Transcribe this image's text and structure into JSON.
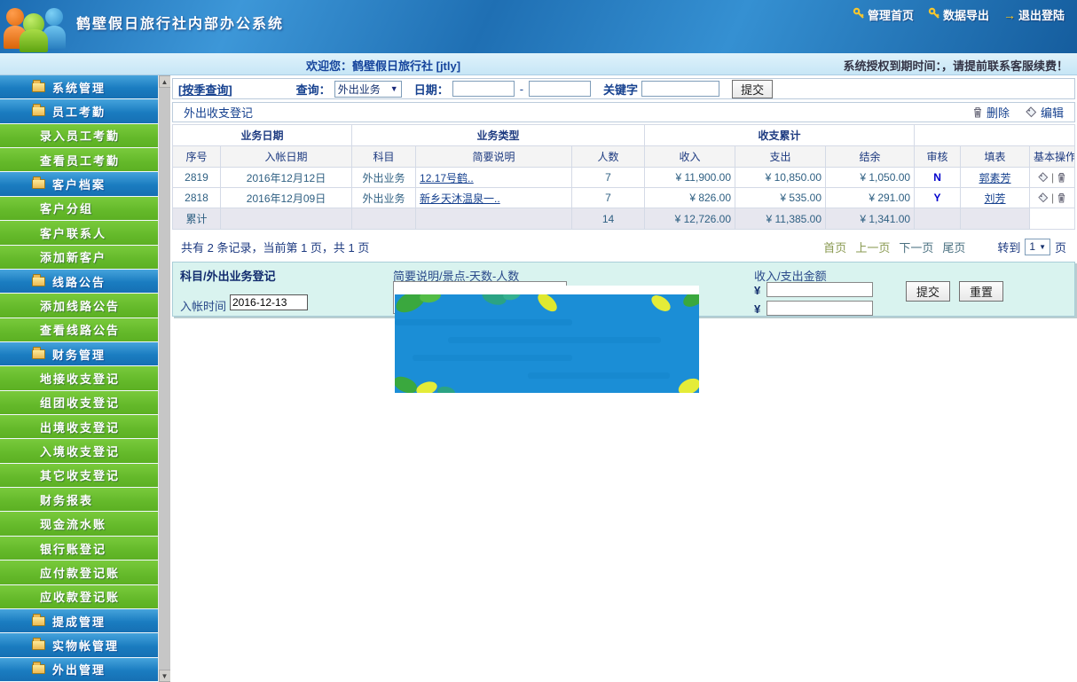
{
  "colors": {
    "income": "#009933",
    "expense": "#ee0000",
    "balance": "#25366e",
    "sidebar_blue": "#1a7cc0",
    "sidebar_green": "#64b92a",
    "header_blue": "#2b87cf",
    "form_bg": "#d9f3ef"
  },
  "icons": {
    "dropdown_arrow": "▼",
    "scroll_up": "▲",
    "scroll_down": "▼",
    "logout_arrow": "→",
    "ops_separator": "|"
  },
  "header": {
    "title": "鹤壁假日旅行社内部办公系统",
    "links": [
      {
        "label": "管理首页",
        "icon": "key-icon"
      },
      {
        "label": "数据导出",
        "icon": "key-icon"
      },
      {
        "label": "退出登陆",
        "icon": "arrow-icon"
      }
    ]
  },
  "welcome_bar": {
    "welcome_text": "欢迎您：鹤壁假日旅行社 [jtly]",
    "license_text": "系统授权到期时间：，请提前联系客服续费！"
  },
  "sidebar": {
    "items": [
      {
        "label": "系统管理",
        "type": "group"
      },
      {
        "label": "员工考勤",
        "type": "group"
      },
      {
        "label": "录入员工考勤",
        "type": "link"
      },
      {
        "label": "查看员工考勤",
        "type": "link"
      },
      {
        "label": "客户档案",
        "type": "group"
      },
      {
        "label": "客户分组",
        "type": "link"
      },
      {
        "label": "客户联系人",
        "type": "link"
      },
      {
        "label": "添加新客户",
        "type": "link"
      },
      {
        "label": "线路公告",
        "type": "group"
      },
      {
        "label": "添加线路公告",
        "type": "link"
      },
      {
        "label": "查看线路公告",
        "type": "link"
      },
      {
        "label": "财务管理",
        "type": "group"
      },
      {
        "label": "地接收支登记",
        "type": "link"
      },
      {
        "label": "组团收支登记",
        "type": "link"
      },
      {
        "label": "出境收支登记",
        "type": "link"
      },
      {
        "label": "入境收支登记",
        "type": "link"
      },
      {
        "label": "其它收支登记",
        "type": "link"
      },
      {
        "label": "财务报表",
        "type": "link"
      },
      {
        "label": "现金流水账",
        "type": "link"
      },
      {
        "label": "银行账登记",
        "type": "link"
      },
      {
        "label": "应付款登记账",
        "type": "link"
      },
      {
        "label": "应收款登记账",
        "type": "link"
      },
      {
        "label": "提成管理",
        "type": "group"
      },
      {
        "label": "实物帐管理",
        "type": "group"
      },
      {
        "label": "外出管理",
        "type": "group"
      }
    ]
  },
  "query_bar": {
    "season_link": "[按季查询]",
    "query_label": "查询：",
    "select_value": "外出业务",
    "date_label": "日期：",
    "date_from": "",
    "date_to": "",
    "separator": "-",
    "keyword_label": "关键字",
    "keyword_value": "",
    "submit_label": "提交"
  },
  "list_header": {
    "title": "外出收支登记",
    "delete_label": "删除",
    "edit_label": "编辑"
  },
  "table": {
    "group_headers": {
      "date": "业务日期",
      "type": "业务类型",
      "totals": "收支累计",
      "blank": ""
    },
    "columns": {
      "seq": "序号",
      "date": "入帐日期",
      "subject": "科目",
      "desc": "简要说明",
      "people": "人数",
      "income": "收入",
      "expense": "支出",
      "balance": "结余",
      "audit": "审核",
      "filler": "填表",
      "ops": "基本操作"
    },
    "rows": [
      {
        "seq": "2819",
        "date": "2016年12月12日",
        "subject": "外出业务",
        "desc": "12.17号鹤..",
        "people": "7",
        "income": "¥ 11,900.00",
        "expense": "¥ 10,850.00",
        "balance": "¥ 1,050.00",
        "audit": "N",
        "filler": "郭素芳"
      },
      {
        "seq": "2818",
        "date": "2016年12月09日",
        "subject": "外出业务",
        "desc": "新乡天沐温泉一..",
        "people": "7",
        "income": "¥ 826.00",
        "expense": "¥ 535.00",
        "balance": "¥ 291.00",
        "audit": "Y",
        "filler": "刘芳"
      }
    ],
    "summary": {
      "label": "累计",
      "people": "14",
      "income": "¥ 12,726.00",
      "expense": "¥ 11,385.00",
      "balance": "¥ 1,341.00"
    }
  },
  "pagination": {
    "summary": "共有 2 条记录，当前第 1 页，共 1 页",
    "first": "首页",
    "prev": "上一页",
    "next": "下一页",
    "last": "尾页",
    "goto_label": "转到",
    "page_value": "1",
    "page_suffix": "页"
  },
  "form": {
    "subject_label": "科目/外出业务登记",
    "time_label": "入帐时间",
    "time_value": "2016-12-13",
    "desc_label": "简要说明/景点-天数-人数",
    "amount_label": "收入/支出金额",
    "currency": "¥",
    "submit_label": "提交",
    "reset_label": "重置"
  }
}
